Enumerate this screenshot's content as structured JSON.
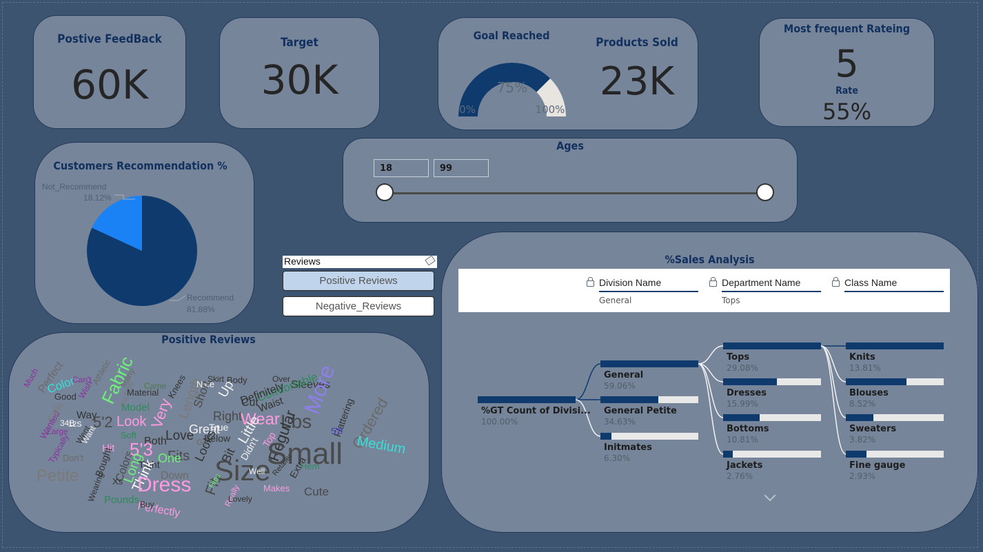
{
  "colors": {
    "background": "#3d5470",
    "card": "#768599",
    "accent": "#0f3a6d",
    "title": "#12305e"
  },
  "positive_feedback": {
    "title": "Postive FeedBack",
    "value": "60K"
  },
  "target": {
    "title": "Target",
    "value": "30K"
  },
  "goal": {
    "title": "Goal Reached",
    "gauge_value": "75%",
    "gauge_min": "0%",
    "gauge_max": "100%",
    "fraction": 0.75
  },
  "products_sold": {
    "title": "Products Sold",
    "value": "23K"
  },
  "rating": {
    "title": "Most frequent Rateing",
    "value": "5",
    "rate_label": "Rate",
    "rate_value": "55%"
  },
  "recommendation": {
    "title": "Customers Recommendation %",
    "not_label": "Not_Recommend",
    "not_value": "18.12%",
    "rec_label": "Recommend",
    "rec_value": "81.88%"
  },
  "chart_data": {
    "type": "pie",
    "title": "Customers Recommendation %",
    "categories": [
      "Recommend",
      "Not_Recommend"
    ],
    "values": [
      81.88,
      18.12
    ],
    "colors": [
      "#0f3a6d",
      "#1a82f5"
    ]
  },
  "ages": {
    "title": "Ages",
    "min": "18",
    "max": "99"
  },
  "reviews_slicer": {
    "title": "Reviews",
    "options": [
      "Positive Reviews",
      "Negative_Reviews"
    ],
    "selected": "Positive Reviews"
  },
  "wordcloud": {
    "title": "Positive Reviews",
    "words": [
      "Much",
      "Perfect",
      "Can't",
      "Wish",
      "Athletic",
      "Fabric",
      "Color",
      "Good",
      "Many",
      "Came",
      "Knees",
      "Skirt",
      "Body",
      "Over",
      "Sleeves",
      "Comfortable",
      "Inches",
      "Material",
      "Length",
      "Nice",
      "Up",
      "Definitely",
      "Wanted",
      "Falls",
      "34B",
      "Way",
      "5'2",
      "Model",
      "Look",
      "Very",
      "Short",
      "Right",
      "Wear",
      "Lbs",
      "More",
      "Flattering",
      "5'8",
      "Large",
      "12S",
      "Soft",
      "Both",
      "Love",
      "Great",
      "Little",
      "Cut",
      "Waist",
      "Below",
      "Regular",
      "Small",
      "Ordered",
      "Medium",
      "Typically",
      "Went",
      "Want",
      "Hit",
      "Colors",
      "5'3",
      "Fits",
      "One",
      "Looks",
      "Fit",
      "Bit",
      "Didn't",
      "Top",
      "Extra",
      "Don't",
      "Bought",
      "Long",
      "Tight",
      "Size",
      "Well",
      "Retailer",
      "Hem",
      "Petite",
      "Wearing",
      "Xs",
      "Think",
      "Dress",
      "Down",
      "Really",
      "Makes",
      "Cute",
      "Pounds",
      "Perfectly",
      "Buy",
      "Lovely",
      "Hips",
      "Go",
      "True"
    ]
  },
  "sales": {
    "title": "%Sales Analysis",
    "levels": [
      {
        "name": "Division Name",
        "value": "General"
      },
      {
        "name": "Department Name",
        "value": "Tops"
      },
      {
        "name": "Class Name",
        "value": ""
      }
    ],
    "root": {
      "label": "%GT Count of Divisi...",
      "pct": "100.00%",
      "fraction": 1.0
    },
    "divisions": [
      {
        "label": "General",
        "pct": "59.06%",
        "fraction": 1.0
      },
      {
        "label": "General Petite",
        "pct": "34.63%",
        "fraction": 0.59
      },
      {
        "label": "Initmates",
        "pct": "6.30%",
        "fraction": 0.11
      }
    ],
    "departments": [
      {
        "label": "Tops",
        "pct": "29.08%",
        "fraction": 1.0
      },
      {
        "label": "Dresses",
        "pct": "15.99%",
        "fraction": 0.55
      },
      {
        "label": "Bottoms",
        "pct": "10.81%",
        "fraction": 0.37
      },
      {
        "label": "Jackets",
        "pct": "2.76%",
        "fraction": 0.1
      }
    ],
    "classes": [
      {
        "label": "Knits",
        "pct": "13.81%",
        "fraction": 1.0
      },
      {
        "label": "Blouses",
        "pct": "8.52%",
        "fraction": 0.62
      },
      {
        "label": "Sweaters",
        "pct": "3.82%",
        "fraction": 0.28
      },
      {
        "label": "Fine gauge",
        "pct": "2.93%",
        "fraction": 0.21
      }
    ]
  }
}
